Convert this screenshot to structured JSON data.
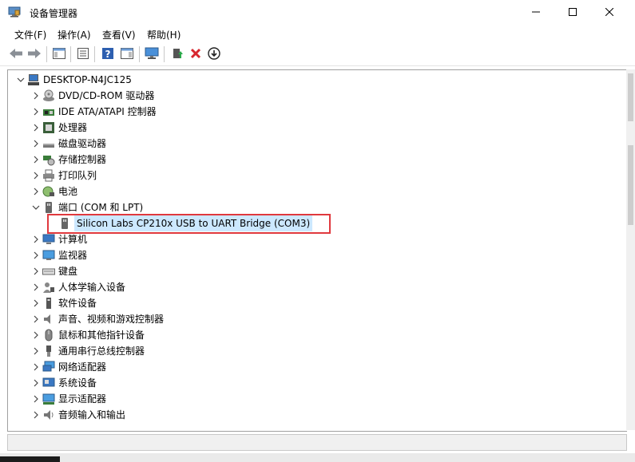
{
  "window": {
    "title": "设备管理器",
    "icon": "device-manager-icon",
    "controls": [
      "minimize-icon",
      "maximize-icon",
      "close-icon"
    ]
  },
  "menu": {
    "file": "文件(F)",
    "action": "操作(A)",
    "view": "查看(V)",
    "help": "帮助(H)"
  },
  "toolbar": {
    "icons": [
      "back-arrow-icon",
      "forward-arrow-icon",
      "show-hide-console-tree-icon",
      "properties-icon",
      "help-icon",
      "action-pane-icon",
      "monitor-icon",
      "update-driver-icon",
      "uninstall-icon",
      "download-icon"
    ]
  },
  "tree": {
    "root": "DESKTOP-N4JC125",
    "items": [
      {
        "label": "DVD/CD-ROM 驱动器",
        "icon": "dvd-drive-icon",
        "expanded": false
      },
      {
        "label": "IDE ATA/ATAPI 控制器",
        "icon": "ide-controller-icon",
        "expanded": false
      },
      {
        "label": "处理器",
        "icon": "processor-icon",
        "expanded": false
      },
      {
        "label": "磁盘驱动器",
        "icon": "disk-drive-icon",
        "expanded": false
      },
      {
        "label": "存储控制器",
        "icon": "storage-controller-icon",
        "expanded": false
      },
      {
        "label": "打印队列",
        "icon": "printer-icon",
        "expanded": false
      },
      {
        "label": "电池",
        "icon": "battery-icon",
        "expanded": false
      },
      {
        "label": "端口 (COM 和 LPT)",
        "icon": "port-icon",
        "expanded": true
      },
      {
        "label": "Silicon Labs CP210x USB to UART Bridge (COM3)",
        "icon": "port-device-icon",
        "child": true,
        "selected": true
      },
      {
        "label": "计算机",
        "icon": "computer-icon",
        "expanded": false
      },
      {
        "label": "监视器",
        "icon": "monitor-icon",
        "expanded": false
      },
      {
        "label": "键盘",
        "icon": "keyboard-icon",
        "expanded": false
      },
      {
        "label": "人体学输入设备",
        "icon": "hid-icon",
        "expanded": false
      },
      {
        "label": "软件设备",
        "icon": "software-device-icon",
        "expanded": false
      },
      {
        "label": "声音、视频和游戏控制器",
        "icon": "speaker-icon",
        "expanded": false
      },
      {
        "label": "鼠标和其他指针设备",
        "icon": "mouse-icon",
        "expanded": false
      },
      {
        "label": "通用串行总线控制器",
        "icon": "usb-icon",
        "expanded": false
      },
      {
        "label": "网络适配器",
        "icon": "network-adapter-icon",
        "expanded": false
      },
      {
        "label": "系统设备",
        "icon": "system-device-icon",
        "expanded": false
      },
      {
        "label": "显示适配器",
        "icon": "display-adapter-icon",
        "expanded": false
      },
      {
        "label": "音频输入和输出",
        "icon": "audio-io-icon",
        "expanded": false
      }
    ]
  },
  "colors": {
    "selection": "#cce8ff",
    "highlight_box": "#e0393e"
  }
}
